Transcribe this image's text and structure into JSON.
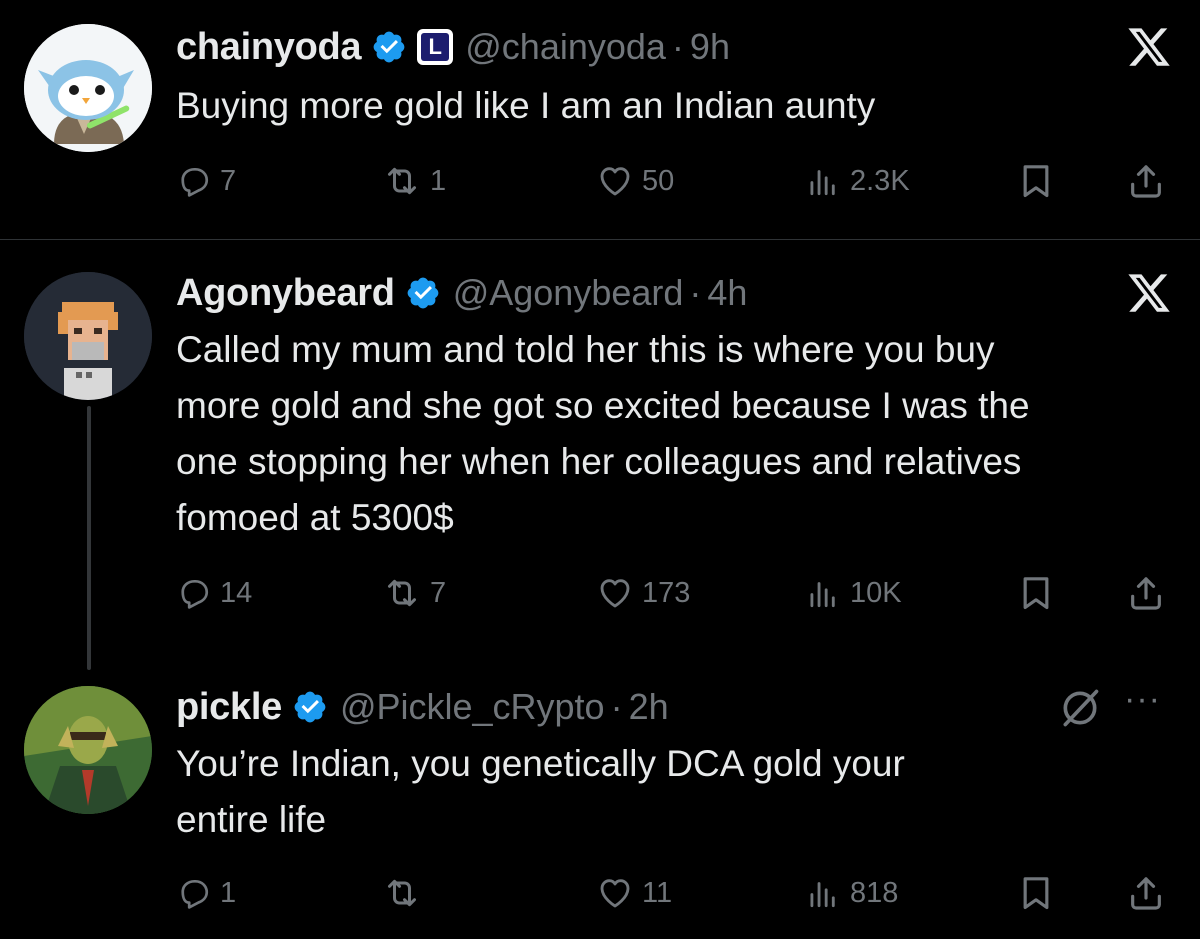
{
  "tweets": [
    {
      "display_name": "chainyoda",
      "handle": "@chainyoda",
      "separator": "·",
      "time": "9h",
      "affiliate_badge": "L",
      "text_lines": [
        "Buying more gold like I am an Indian aunty"
      ],
      "replies": "7",
      "reposts": "1",
      "likes": "50",
      "views": "2.3K"
    },
    {
      "display_name": "Agonybeard",
      "handle": "@Agonybeard",
      "separator": "·",
      "time": "4h",
      "text_lines": [
        "Called my mum and told her this is where you buy",
        "more gold and she got so excited because I was the",
        "one stopping her when her colleagues and relatives",
        "fomoed at 5300$"
      ],
      "replies": "14",
      "reposts": "7",
      "likes": "173",
      "views": "10K"
    },
    {
      "display_name": "pickle",
      "handle": "@Pickle_cRypto",
      "separator": "·",
      "time": "2h",
      "more_label": "···",
      "text_lines": [
        "You’re Indian, you genetically DCA gold your",
        "entire life"
      ],
      "replies": "1",
      "reposts": "",
      "likes": "11",
      "views": "818"
    }
  ],
  "colors": {
    "background": "#000000",
    "text": "#e7e9ea",
    "muted": "#71767b",
    "verified_blue": "#1d9bf0",
    "divider": "#2f3336",
    "affiliate_navy": "#1c1d6e"
  },
  "icons": {
    "reply": "reply-icon",
    "repost": "repost-icon",
    "like": "heart-icon",
    "views": "views-icon",
    "bookmark": "bookmark-icon",
    "share": "share-icon",
    "x_logo": "x-logo-icon",
    "grok": "grok-icon",
    "verified": "verified-badge-icon"
  }
}
